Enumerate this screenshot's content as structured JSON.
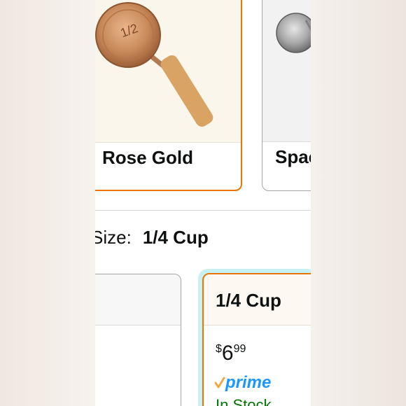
{
  "colors_section": {
    "options": [
      {
        "label": "Rose Gold",
        "selected": true
      },
      {
        "label": "Spac",
        "selected": false
      }
    ]
  },
  "size_section": {
    "label": "Size:",
    "selected_value": "1/4 Cup"
  },
  "size_options": [
    {
      "title": "",
      "selected": false
    },
    {
      "title": "1/4 Cup",
      "selected": true,
      "price_symbol": "$",
      "price_whole": "6",
      "price_fraction": "99",
      "prime_label": "prime",
      "availability": "In Stock"
    }
  ],
  "theme": {
    "accent": "#e77600",
    "prime_blue": "#1a98ff",
    "in_stock_green": "#007600"
  }
}
